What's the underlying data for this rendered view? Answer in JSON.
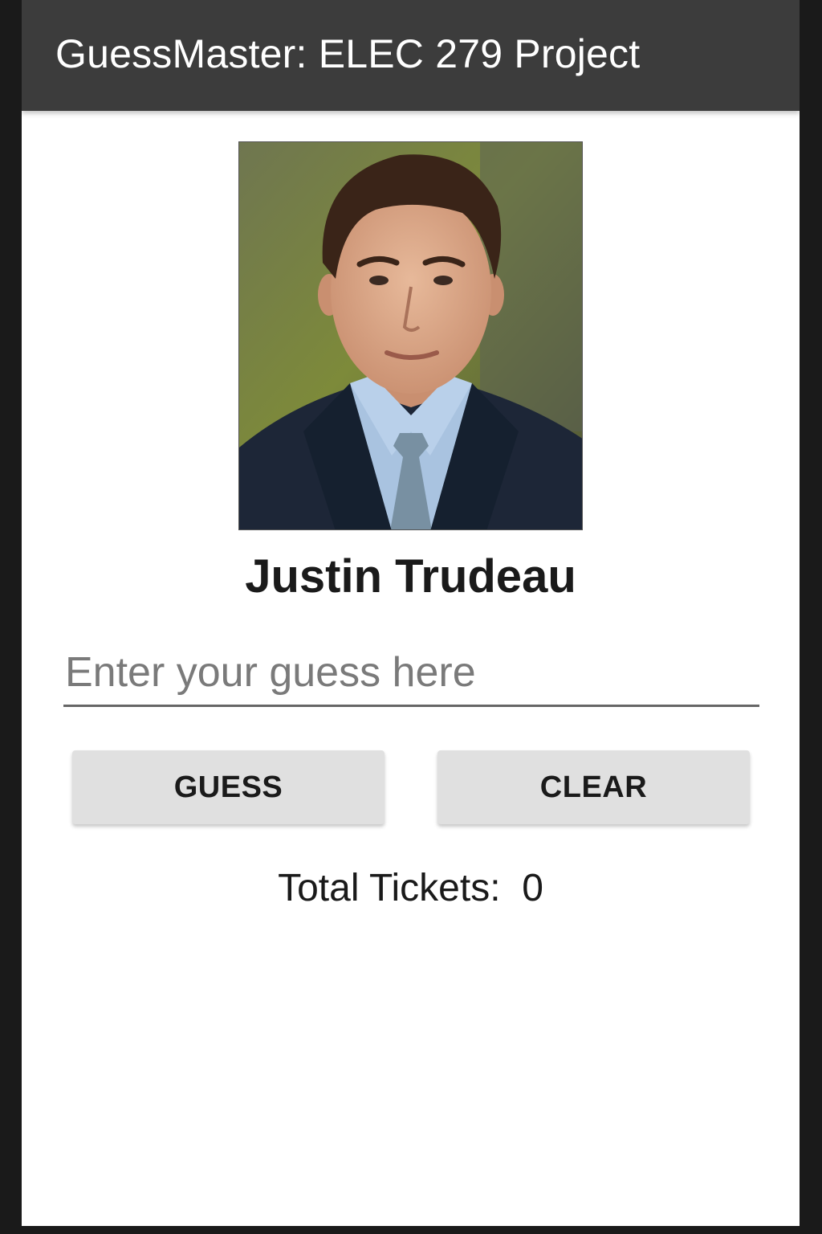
{
  "app_bar": {
    "title": "GuessMaster: ELEC 279 Project",
    "background_color": "#3c3c3c"
  },
  "portrait": {
    "icon": "person-portrait"
  },
  "entity": {
    "name": "Justin Trudeau"
  },
  "guess_input": {
    "value": "",
    "placeholder": "Enter your guess here"
  },
  "buttons": {
    "guess_label": "GUESS",
    "clear_label": "CLEAR"
  },
  "tickets": {
    "label": "Total Tickets:",
    "count": "0"
  }
}
